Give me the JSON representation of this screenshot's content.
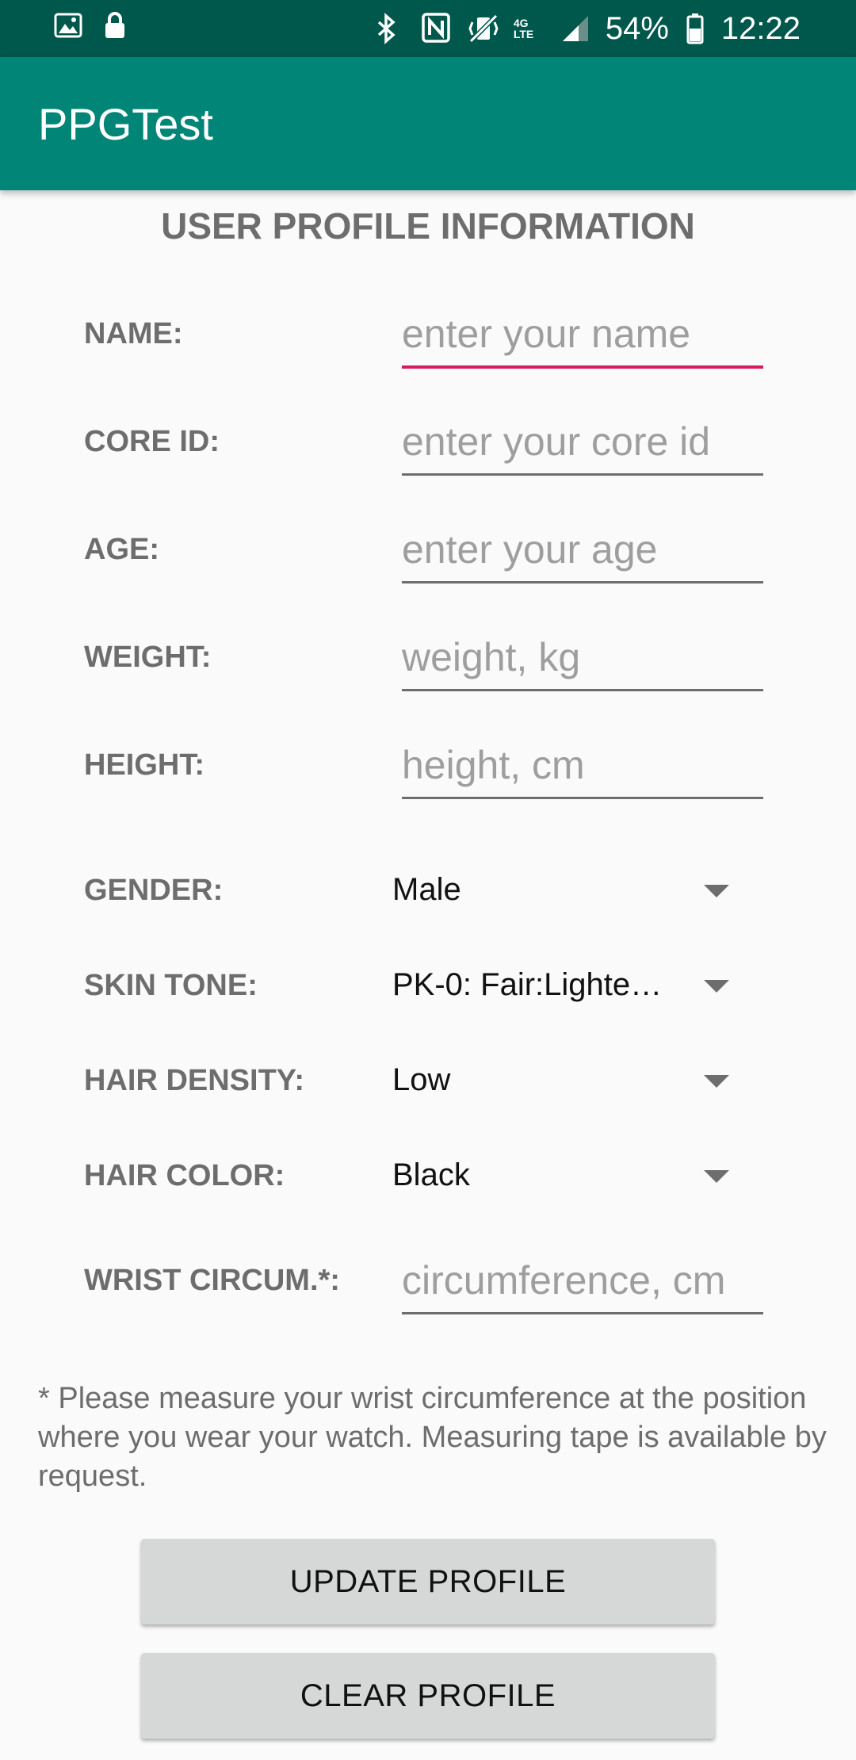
{
  "status_bar": {
    "battery": "54%",
    "time": "12:22",
    "network": "4G LTE",
    "left_icons": [
      "image-icon",
      "lock-icon"
    ],
    "right_icons": [
      "bluetooth-icon",
      "nfc-icon",
      "vibrate-icon",
      "signal-icon",
      "battery-icon"
    ]
  },
  "app_bar": {
    "title": "PPGTest"
  },
  "form": {
    "title": "USER PROFILE INFORMATION",
    "name": {
      "label": "NAME:",
      "placeholder": "enter your name",
      "value": ""
    },
    "core_id": {
      "label": "CORE ID:",
      "placeholder": "enter your core id",
      "value": ""
    },
    "age": {
      "label": "AGE:",
      "placeholder": "enter your age",
      "value": ""
    },
    "weight": {
      "label": "WEIGHT:",
      "placeholder": "weight, kg",
      "value": ""
    },
    "height": {
      "label": "HEIGHT:",
      "placeholder": "height, cm",
      "value": ""
    },
    "gender": {
      "label": "GENDER:",
      "value": "Male"
    },
    "skin_tone": {
      "label": "SKIN TONE:",
      "value": "PK-0: Fair:Lighte…"
    },
    "hair_density": {
      "label": "HAIR DENSITY:",
      "value": "Low"
    },
    "hair_color": {
      "label": "HAIR COLOR:",
      "value": "Black"
    },
    "wrist": {
      "label": "WRIST CIRCUM.*:",
      "placeholder": "circumference, cm",
      "value": ""
    },
    "note": "* Please measure your wrist circumference at the position where you wear your watch. Measuring tape is available by request.",
    "update_button": "UPDATE PROFILE",
    "clear_button": "CLEAR PROFILE"
  },
  "colors": {
    "status_bar": "#00574b",
    "app_bar": "#008577",
    "accent": "#d81b60",
    "button": "#d6d7d7"
  }
}
